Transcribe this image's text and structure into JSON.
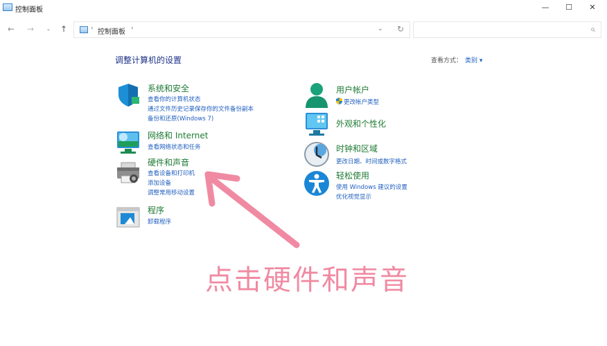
{
  "window": {
    "title": "控制面板",
    "minimize": "—",
    "maximize": "☐",
    "close": "✕"
  },
  "nav": {
    "back": "←",
    "forward": "→",
    "recent": "⌄",
    "up": "↑",
    "crumb_separator": "›",
    "breadcrumb": "控制面板",
    "dropdown": "⌄",
    "refresh": "↻",
    "search_icon": "⌕"
  },
  "main": {
    "heading": "调整计算机的设置",
    "view_by_label": "查看方式：",
    "view_by_value": "类别 ▾"
  },
  "categories_left": [
    {
      "title": "系统和安全",
      "icon": "shield-icon",
      "links": [
        "查看你的计算机状态",
        "通过文件历史记录保存你的文件备份副本",
        "备份和还原(Windows 7)"
      ]
    },
    {
      "title": "网络和 Internet",
      "icon": "network-icon",
      "links": [
        "查看网络状态和任务"
      ]
    },
    {
      "title": "硬件和声音",
      "icon": "printer-icon",
      "links": [
        "查看设备和打印机",
        "添加设备",
        "调整常用移动设置"
      ]
    },
    {
      "title": "程序",
      "icon": "programs-icon",
      "links": [
        "卸载程序"
      ]
    }
  ],
  "categories_right": [
    {
      "title": "用户帐户",
      "icon": "user-icon",
      "links": [
        "更改帐户类型"
      ]
    },
    {
      "title": "外观和个性化",
      "icon": "appearance-icon",
      "links": []
    },
    {
      "title": "时钟和区域",
      "icon": "clock-icon",
      "links": [
        "更改日期、时间或数字格式"
      ]
    },
    {
      "title": "轻松使用",
      "icon": "accessibility-icon",
      "links": [
        "使用 Windows 建议的设置",
        "优化视觉显示"
      ]
    }
  ],
  "annotation": {
    "text": "点击硬件和声音",
    "color": "#f08aa2"
  },
  "colors": {
    "category_title": "#1e7a33",
    "link": "#1f5fbf",
    "heading": "#1e3287"
  }
}
